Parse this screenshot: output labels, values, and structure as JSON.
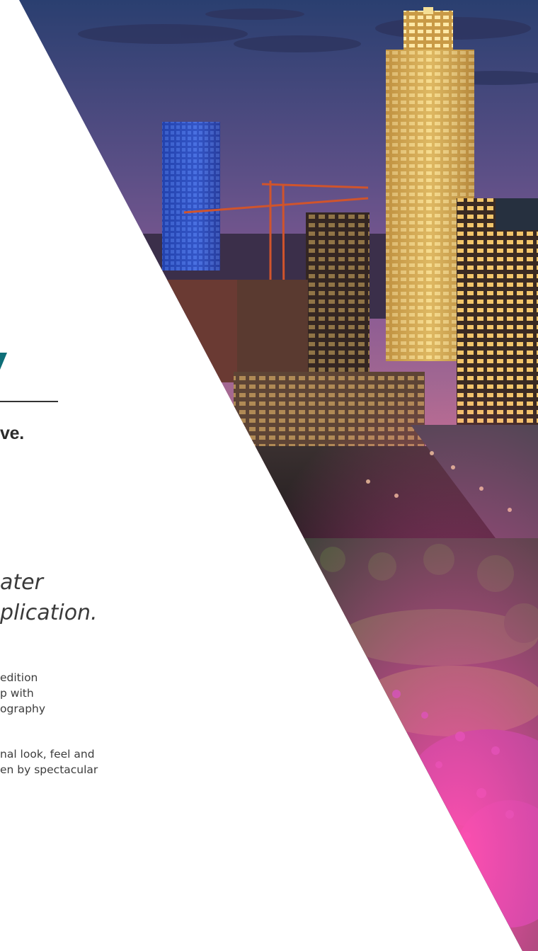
{
  "page": {
    "tagline_fragment": "ve.",
    "lead_line_1": "ater",
    "lead_line_2": "plication.",
    "body_paragraph_1": [
      "edition",
      "p with",
      "ography"
    ],
    "body_paragraph_2": [
      "nal look, feel and",
      "en by spectacular"
    ]
  },
  "colors": {
    "accent_teal": "#0e6e78",
    "text_dark": "#2b2b2b",
    "sky_top": "#2a3f70",
    "sky_mid": "#8a5b94",
    "sky_horizon": "#d38a8a"
  }
}
